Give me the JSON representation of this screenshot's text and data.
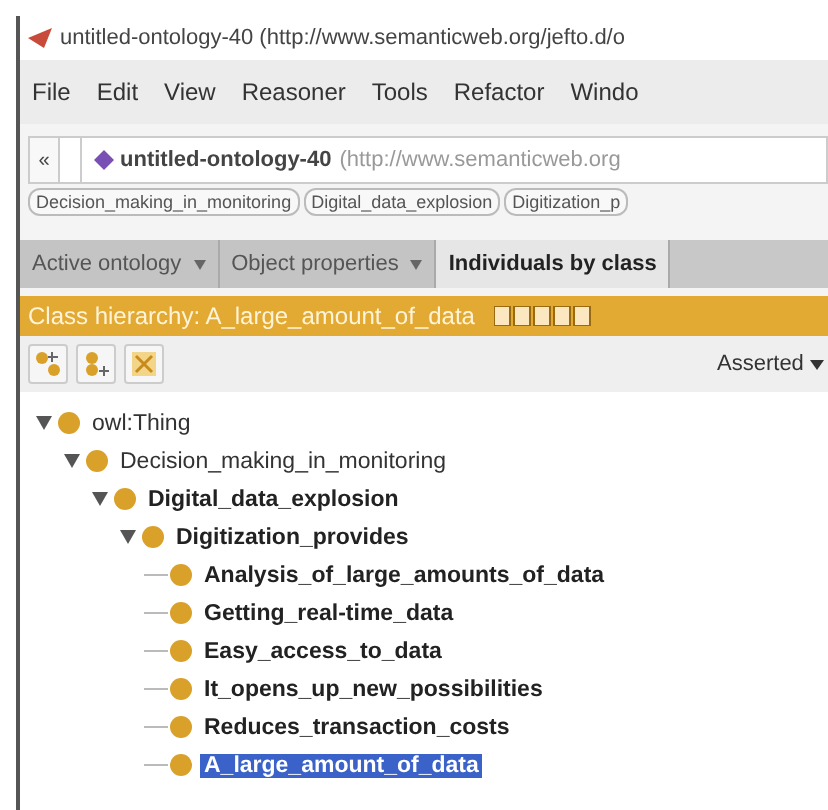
{
  "window": {
    "title": "untitled-ontology-40 (http://www.semanticweb.org/jefto.d/o"
  },
  "menu": [
    "File",
    "Edit",
    "View",
    "Reasoner",
    "Tools",
    "Refactor",
    "Windo"
  ],
  "address_bar": {
    "back": "«",
    "ontology": "untitled-ontology-40",
    "iri": "(http://www.semanticweb.org"
  },
  "breadcrumbs": [
    "Decision_making_in_monitoring",
    "Digital_data_explosion",
    "Digitization_p"
  ],
  "tabs": [
    {
      "label": "Active ontology",
      "selected": false
    },
    {
      "label": "Object properties",
      "selected": false
    },
    {
      "label": "Individuals by class",
      "selected": true
    }
  ],
  "panel": {
    "title": "Class hierarchy: A_large_amount_of_data",
    "view_mode": "Asserted"
  },
  "tree": [
    {
      "label": "owl:Thing",
      "bold": false,
      "expanded": true,
      "selected": false,
      "children": [
        {
          "label": "Decision_making_in_monitoring",
          "bold": false,
          "expanded": true,
          "selected": false,
          "children": [
            {
              "label": "Digital_data_explosion",
              "bold": true,
              "expanded": true,
              "selected": false,
              "children": [
                {
                  "label": "Digitization_provides",
                  "bold": true,
                  "expanded": true,
                  "selected": false,
                  "children": [
                    {
                      "label": "Analysis_of_large_amounts_of_data",
                      "bold": true,
                      "selected": false
                    },
                    {
                      "label": "Getting_real-time_data",
                      "bold": true,
                      "selected": false
                    },
                    {
                      "label": "Easy_access_to_data",
                      "bold": true,
                      "selected": false
                    },
                    {
                      "label": "It_opens_up_new_possibilities",
                      "bold": true,
                      "selected": false
                    },
                    {
                      "label": "Reduces_transaction_costs",
                      "bold": true,
                      "selected": false
                    },
                    {
                      "label": "A_large_amount_of_data",
                      "bold": true,
                      "selected": true
                    }
                  ]
                }
              ]
            }
          ]
        }
      ]
    }
  ]
}
